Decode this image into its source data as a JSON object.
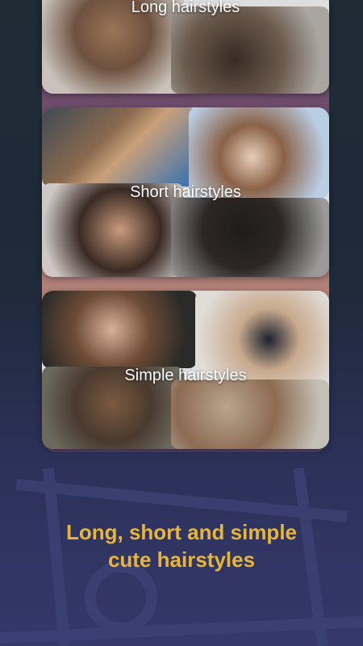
{
  "cards": [
    {
      "label": "Long hairstyles"
    },
    {
      "label": "Short hairstyles"
    },
    {
      "label": "Simple hairstyles"
    }
  ],
  "headline": {
    "line1": "Long, short and simple",
    "line2": "cute hairstyles"
  },
  "colors": {
    "accent": "#e8b53a",
    "background_top": "#1f2b35",
    "background_bottom": "#34386b"
  }
}
